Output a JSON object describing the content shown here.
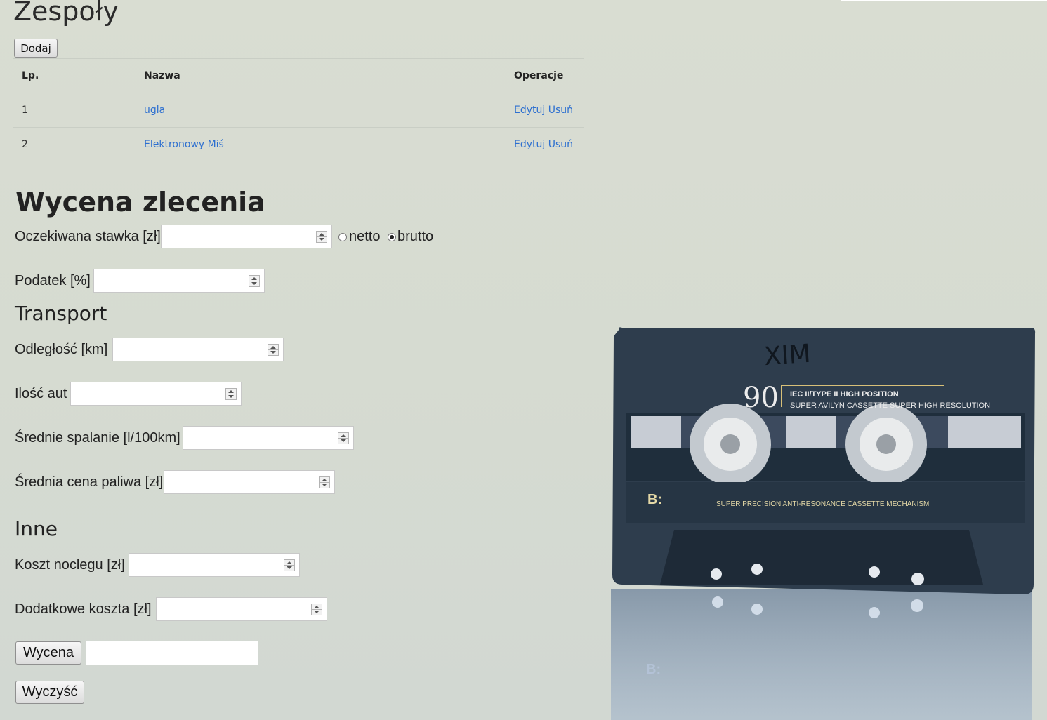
{
  "teams": {
    "title": "Zespoły",
    "add_label": "Dodaj",
    "columns": [
      "Lp.",
      "Nazwa",
      "Operacje"
    ],
    "rows": [
      {
        "lp": "1",
        "name": "ugla",
        "edit": "Edytuj",
        "delete": "Usuń"
      },
      {
        "lp": "2",
        "name": "Elektronowy Miś",
        "edit": "Edytuj",
        "delete": "Usuń"
      }
    ]
  },
  "quote": {
    "title": "Wycena zlecenia",
    "expected_rate_label": "Oczekiwana stawka [zł]",
    "expected_rate_value": "",
    "netto_label": "netto",
    "brutto_label": "brutto",
    "selected_mode": "brutto",
    "tax_label": "Podatek [%]",
    "tax_value": ""
  },
  "transport": {
    "title": "Transport",
    "distance_label": "Odległość [km]",
    "distance_value": "",
    "cars_label": "Ilość aut",
    "cars_value": "",
    "consumption_label": "Średnie spalanie [l/100km]",
    "consumption_value": "",
    "fuel_price_label": "Średnia cena paliwa [zł]",
    "fuel_price_value": ""
  },
  "other": {
    "title": "Inne",
    "lodging_label": "Koszt noclegu [zł]",
    "lodging_value": "",
    "extra_costs_label": "Dodatkowe koszta [zł]",
    "extra_costs_value": ""
  },
  "actions": {
    "quote_label": "Wycena",
    "result_value": "",
    "clear_label": "Wyczyść"
  },
  "background_photo": {
    "cassette_number": "90",
    "cassette_handwriting": "XIM",
    "type_text": "IEC II/TYPE II  HIGH POSITION",
    "brand_text": "SUPER AVILYN CASSETTE SUPER HIGH RESOLUTION",
    "side_text": "B:",
    "mechanism_text": "SUPER PRECISION ANTI-RESONANCE CASSETTE MECHANISM"
  },
  "colors": {
    "link": "#2d6fd0",
    "background": "#d7dbd1",
    "cassette": "#2e3d4d"
  }
}
